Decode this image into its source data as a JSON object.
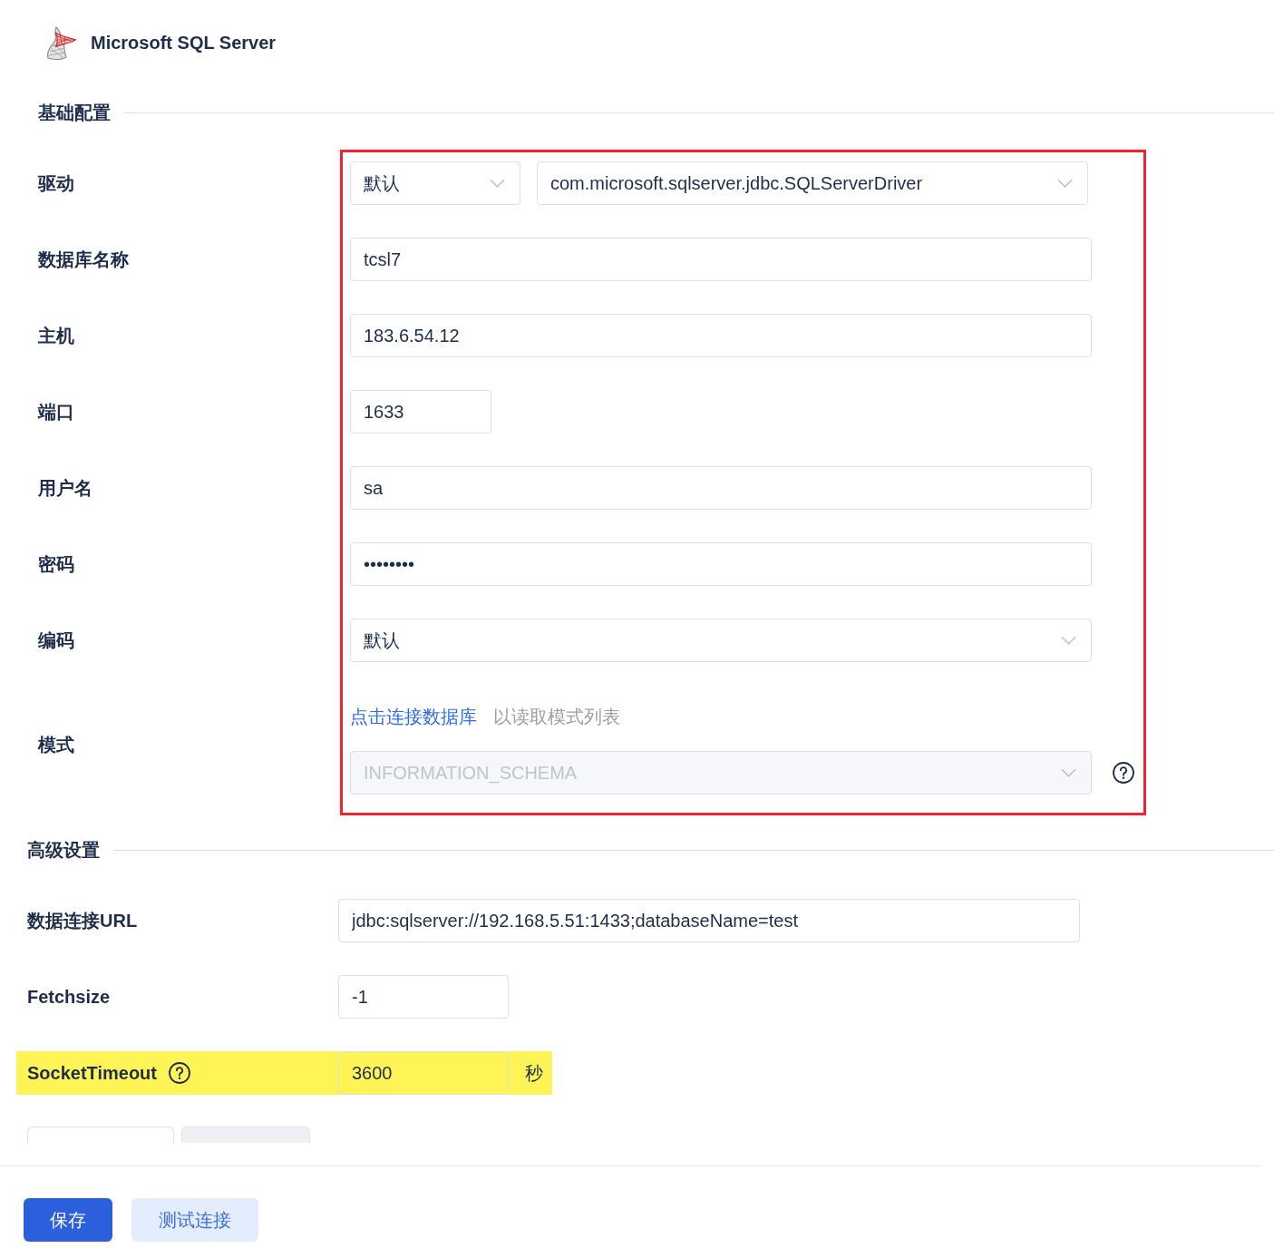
{
  "header": {
    "title": "Microsoft SQL Server"
  },
  "basic": {
    "title": "基础配置",
    "outlined": true,
    "fields": [
      {
        "kind": "pair",
        "label": "驱动",
        "selects": [
          {
            "value": "默认"
          },
          {
            "value": "com.microsoft.sqlserver.jdbc.SQLServerDriver"
          }
        ]
      },
      {
        "kind": "text",
        "label": "数据库名称",
        "value": "tcsl7"
      },
      {
        "kind": "text",
        "label": "主机",
        "value": "183.6.54.12"
      },
      {
        "kind": "narrow",
        "label": "端口",
        "value": "1633"
      },
      {
        "kind": "text",
        "label": "用户名",
        "value": "sa"
      },
      {
        "kind": "password",
        "label": "密码",
        "value": "••••••••"
      },
      {
        "kind": "select",
        "label": "编码",
        "value": "默认"
      },
      {
        "kind": "schema",
        "label": "模式",
        "link": "点击连接数据库",
        "hint": "以读取模式列表",
        "value": "INFORMATION_SCHEMA",
        "disabled": true
      }
    ]
  },
  "advanced": {
    "title": "高级设置",
    "fields": [
      {
        "kind": "text",
        "label": "数据连接URL",
        "value": "jdbc:sqlserver://192.168.5.51:1433;databaseName=test",
        "highlighted": false
      },
      {
        "kind": "short",
        "label": "Fetchsize",
        "value": "-1",
        "highlighted": false
      },
      {
        "kind": "short",
        "label": "SocketTimeout",
        "help": true,
        "value": "3600",
        "unit": "秒",
        "highlighted": true
      }
    ]
  },
  "tabs": [
    {
      "selected": true
    },
    {
      "selected": false
    }
  ],
  "buttons": [
    {
      "kind": "primary",
      "label": "保存"
    },
    {
      "kind": "secondary",
      "label": "测试连接"
    }
  ]
}
